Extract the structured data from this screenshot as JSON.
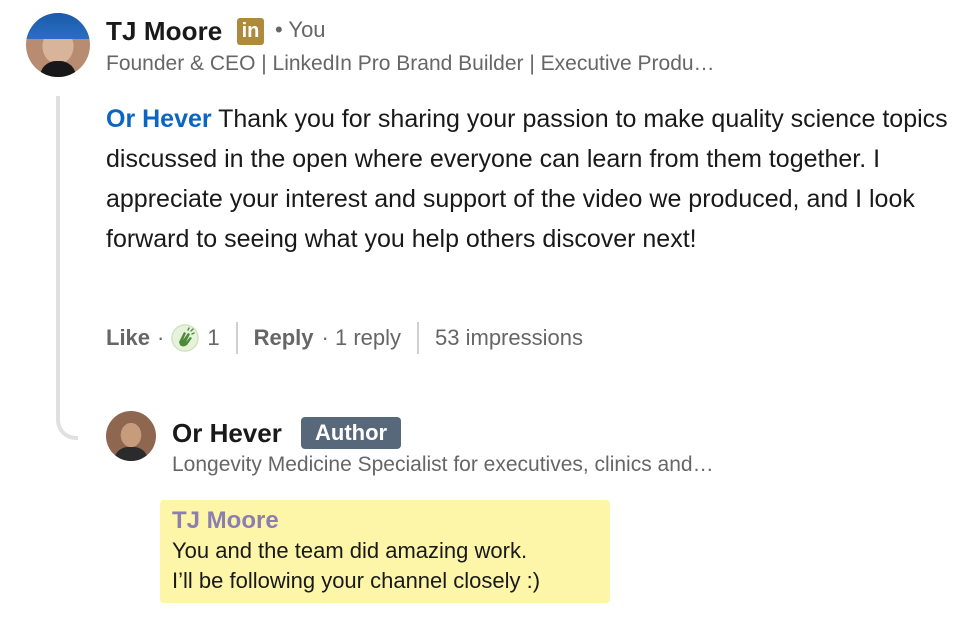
{
  "comment": {
    "author": {
      "name": "TJ Moore",
      "badge_icon": "linkedin-icon",
      "badge_text": "in",
      "you_label": "• You",
      "headline": "Founder & CEO | LinkedIn Pro Brand Builder | Executive Produ…"
    },
    "mention": "Or Hever",
    "text": "Thank you for sharing your passion to make quality science topics discussed in the open where everyone can learn from them together. I appreciate your interest and support of the video we produced, and I look forward to seeing what you help others discover next!",
    "actions": {
      "like_label": "Like",
      "dot": "·",
      "reaction_icon": "clap-icon",
      "reaction_count": "1",
      "reply_label": "Reply",
      "reply_count": "· 1 reply",
      "impressions": "53 impressions"
    }
  },
  "reply": {
    "author": {
      "name": "Or Hever",
      "badge": "Author",
      "headline": "Longevity Medicine Specialist for executives, clinics and…"
    },
    "mention": "TJ Moore",
    "lines": [
      "You and the team did amazing work.",
      "I’ll be following your channel closely :)"
    ],
    "highlight_color": "#fdf6a8"
  },
  "colors": {
    "mention": "#0a66c2",
    "secondary_text": "#666666",
    "author_badge": "#56687a",
    "linkedin_badge": "#b08a3c"
  }
}
